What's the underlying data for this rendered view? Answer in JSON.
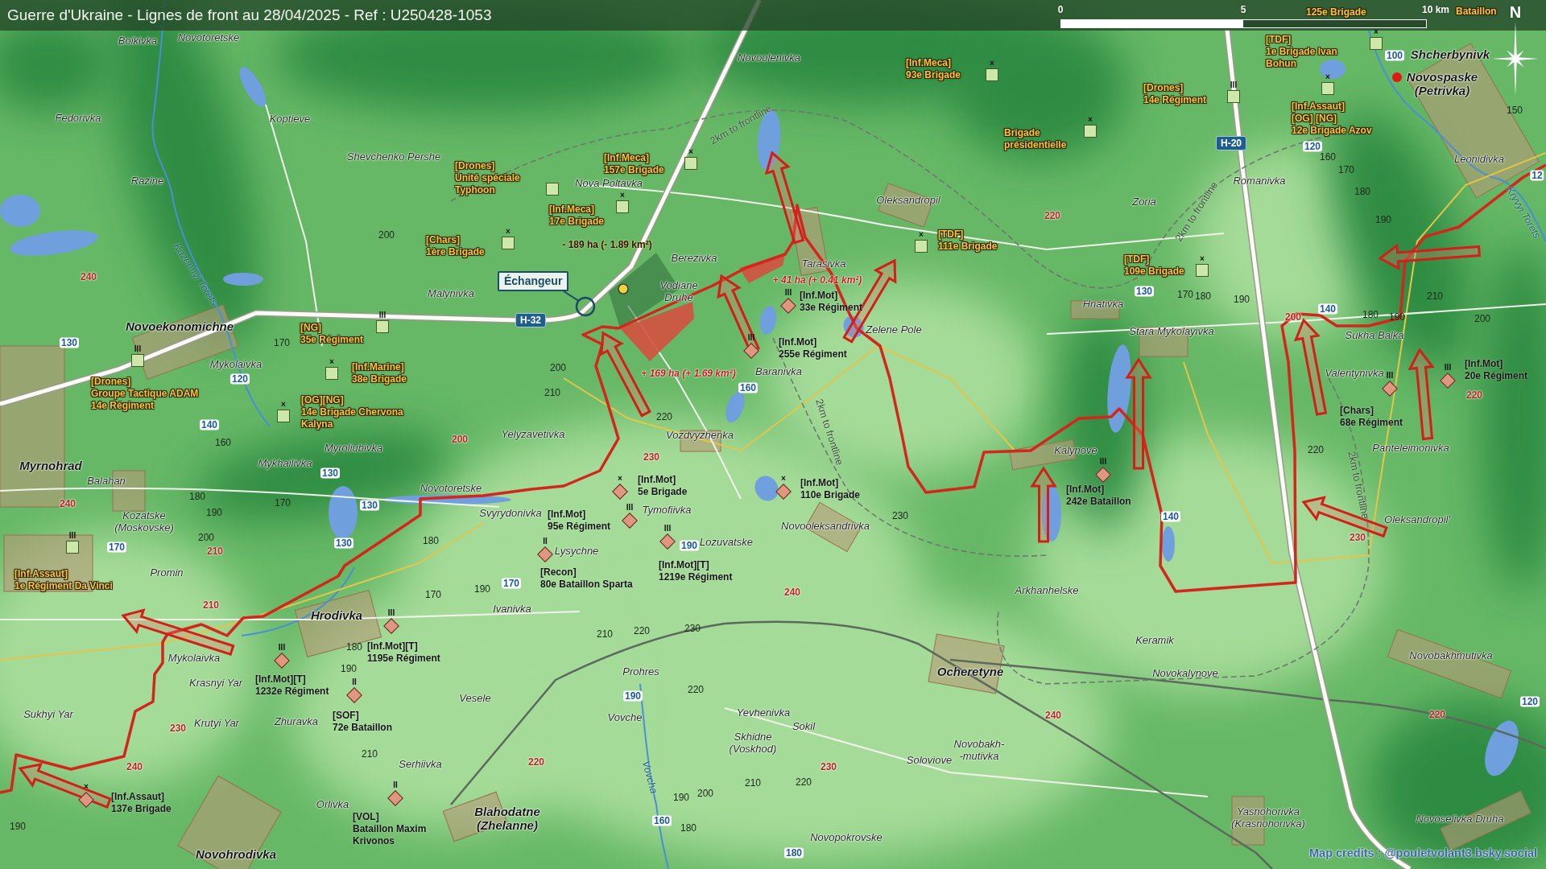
{
  "header": {
    "title": "Guerre d'Ukraine - Lignes de front au 28/04/2025 - Ref : U250428-1053"
  },
  "scale_bar": {
    "ticks": [
      "0",
      "5",
      "10 km"
    ]
  },
  "compass": {
    "label": "N"
  },
  "units": [
    {
      "kind": "ukraine",
      "lines": [
        "125e Brigade"
      ]
    },
    {
      "kind": "ukraine",
      "lines": [
        "Bataillon"
      ]
    },
    {
      "kind": "ukraine",
      "echelon": "×",
      "lines": [
        "[Inf.Meca]",
        "93e Brigade"
      ]
    },
    {
      "kind": "ukraine",
      "echelon": "×",
      "lines": [
        "[TDF]",
        "1e Brigade Ivan",
        "Bohun"
      ]
    },
    {
      "kind": "ukraine",
      "echelon": "III",
      "lines": [
        "[Drones]",
        "14e Régiment"
      ]
    },
    {
      "kind": "ukraine",
      "echelon": "×",
      "lines": [
        "Brigade",
        "présidentielle"
      ]
    },
    {
      "kind": "ukraine",
      "echelon": "×",
      "lines": [
        "[Inf.Assaut]",
        "[OG] [NG]",
        "12e Brigade Azov"
      ]
    },
    {
      "kind": "ukraine",
      "lines": [
        "[Drones]",
        "Unité spéciale",
        "Typhoon"
      ]
    },
    {
      "kind": "ukraine",
      "echelon": "×",
      "lines": [
        "[Inf.Meca]",
        "157e Brigade"
      ]
    },
    {
      "kind": "ukraine",
      "echelon": "×",
      "lines": [
        "[Inf.Meca]",
        "17e Brigade"
      ]
    },
    {
      "kind": "ukraine",
      "echelon": "×",
      "lines": [
        "[Chars]",
        "1ère Brigade"
      ]
    },
    {
      "kind": "ukraine",
      "echelon": "×",
      "lines": [
        "[TDF]",
        "111e Brigade"
      ]
    },
    {
      "kind": "ukraine",
      "echelon": "×",
      "lines": [
        "[TDF]",
        "109e Brigade"
      ]
    },
    {
      "kind": "russia",
      "echelon": "III",
      "lines": [
        "[Inf.Mot]",
        "33e Régiment"
      ]
    },
    {
      "kind": "ukraine",
      "echelon": "III",
      "lines": [
        "[NG]",
        "35e Régiment"
      ]
    },
    {
      "kind": "russia",
      "echelon": "III",
      "lines": [
        "[Inf.Mot]",
        "255e Régiment"
      ]
    },
    {
      "kind": "ukraine",
      "echelon": "III",
      "lines": [
        "[Drones]",
        "Groupe Tactique ADAM",
        "14e Régiment"
      ]
    },
    {
      "kind": "ukraine",
      "echelon": "×",
      "lines": [
        "[Inf.Marine]",
        "38e Brigade"
      ]
    },
    {
      "kind": "russia",
      "echelon": "III",
      "lines": [
        "[Inf.Mot]",
        "20e Régiment"
      ]
    },
    {
      "kind": "ukraine",
      "echelon": "×",
      "lines": [
        "[OG][NG]",
        "14e Brigade Chervona",
        "Kalyna"
      ]
    },
    {
      "kind": "russia",
      "echelon": "III",
      "lines": [
        "[Chars]",
        "68e Régiment"
      ]
    },
    {
      "kind": "russia",
      "echelon": "×",
      "lines": [
        "[Inf.Mot]",
        "5e Brigade"
      ]
    },
    {
      "kind": "russia",
      "echelon": "×",
      "lines": [
        "[Inf.Mot]",
        "110e Brigade"
      ]
    },
    {
      "kind": "russia",
      "echelon": "III",
      "lines": [
        "[Inf.Mot]",
        "242e Bataillon"
      ]
    },
    {
      "kind": "russia",
      "echelon": "III",
      "lines": [
        "[Inf.Mot]",
        "95e Régiment"
      ]
    },
    {
      "kind": "ukraine",
      "echelon": "III",
      "lines": [
        "[Inf.Assaut]",
        "1e Régiment Da Vinci"
      ]
    },
    {
      "kind": "russia",
      "echelon": "II",
      "lines": [
        "[Recon]",
        "80e Bataillon Sparta"
      ]
    },
    {
      "kind": "russia",
      "echelon": "III",
      "lines": [
        "[Inf.Mot][T]",
        "1219e Régiment"
      ]
    },
    {
      "kind": "russia",
      "echelon": "III",
      "lines": [
        "[Inf.Mot][T]",
        "1195e Régiment"
      ]
    },
    {
      "kind": "russia",
      "echelon": "III",
      "lines": [
        "[Inf.Mot][T]",
        "1232e Régiment"
      ]
    },
    {
      "kind": "russia",
      "echelon": "II",
      "lines": [
        "[SOF]",
        "72e Bataillon"
      ]
    },
    {
      "kind": "russia",
      "echelon": "×",
      "lines": [
        "[Inf.Assaut]",
        "137e Brigade"
      ]
    },
    {
      "kind": "russia",
      "echelon": "II",
      "lines": [
        "[VOL]",
        "Bataillon Maxim",
        "Krivonos"
      ]
    }
  ],
  "places": [
    {
      "kind": "village",
      "lines": [
        "Boikivka"
      ]
    },
    {
      "kind": "village",
      "lines": [
        "Novotoretske"
      ]
    },
    {
      "kind": "village",
      "lines": [
        "Novoolenivka"
      ]
    },
    {
      "kind": "town",
      "lines": [
        "Shcherbynivk"
      ]
    },
    {
      "kind": "town",
      "lines": [
        "Novospaske",
        "(Petrivka)"
      ]
    },
    {
      "kind": "village",
      "lines": [
        "Fedorivka"
      ]
    },
    {
      "kind": "village",
      "lines": [
        "Koptieve"
      ]
    },
    {
      "kind": "village",
      "lines": [
        "Shevchenko Pershe"
      ]
    },
    {
      "kind": "village",
      "lines": [
        "Leonidivka"
      ]
    },
    {
      "kind": "village",
      "lines": [
        "Razine"
      ]
    },
    {
      "kind": "village",
      "lines": [
        "Nova Poltavka"
      ]
    },
    {
      "kind": "village",
      "lines": [
        "Romanivka"
      ]
    },
    {
      "kind": "village",
      "lines": [
        "Oleksandropil"
      ]
    },
    {
      "kind": "village",
      "lines": [
        "Zoria"
      ]
    },
    {
      "kind": "village",
      "lines": [
        "Berezivka"
      ]
    },
    {
      "kind": "village",
      "lines": [
        "Tarasivka"
      ]
    },
    {
      "kind": "village",
      "lines": [
        "Malynivka"
      ]
    },
    {
      "kind": "village",
      "lines": [
        "Vodiane",
        "Druhe"
      ]
    },
    {
      "kind": "village",
      "lines": [
        "Hnativka"
      ]
    },
    {
      "kind": "town",
      "lines": [
        "Novoekonomichne"
      ]
    },
    {
      "kind": "village",
      "lines": [
        "Zelene Pole"
      ]
    },
    {
      "kind": "village",
      "lines": [
        "Stara Mykolayivka"
      ]
    },
    {
      "kind": "village",
      "lines": [
        "Sukha Balka"
      ]
    },
    {
      "kind": "village",
      "lines": [
        "Mykolaivka"
      ]
    },
    {
      "kind": "village",
      "lines": [
        "Baranivka"
      ]
    },
    {
      "kind": "village",
      "lines": [
        "Valentynivka"
      ]
    },
    {
      "kind": "village",
      "lines": [
        "Yelyzavetivka"
      ]
    },
    {
      "kind": "village",
      "lines": [
        "Vozdvyzhenka"
      ]
    },
    {
      "kind": "village",
      "lines": [
        "Myroliubivka"
      ]
    },
    {
      "kind": "village",
      "lines": [
        "Kalynove"
      ]
    },
    {
      "kind": "village",
      "lines": [
        "Panteleimonivka"
      ]
    },
    {
      "kind": "town",
      "lines": [
        "Myrnohrad"
      ]
    },
    {
      "kind": "village",
      "lines": [
        "Mykhailivka"
      ]
    },
    {
      "kind": "village",
      "lines": [
        "Balahan"
      ]
    },
    {
      "kind": "village",
      "lines": [
        "Novotoretske"
      ]
    },
    {
      "kind": "village",
      "lines": [
        "Kozatske",
        "(Moskovske)"
      ]
    },
    {
      "kind": "village",
      "lines": [
        "Svyrydonivka"
      ]
    },
    {
      "kind": "village",
      "lines": [
        "Tymofiivka"
      ]
    },
    {
      "kind": "village",
      "lines": [
        "Novooleksandrivka"
      ]
    },
    {
      "kind": "village",
      "lines": [
        "Oleksandropil'"
      ]
    },
    {
      "kind": "village",
      "lines": [
        "Lysychne"
      ]
    },
    {
      "kind": "village",
      "lines": [
        "Lozuvatske"
      ]
    },
    {
      "kind": "village",
      "lines": [
        "Promin"
      ]
    },
    {
      "kind": "village",
      "lines": [
        "Arkhanhelske"
      ]
    },
    {
      "kind": "town",
      "lines": [
        "Hrodivka"
      ]
    },
    {
      "kind": "village",
      "lines": [
        "Ivanivka"
      ]
    },
    {
      "kind": "village",
      "lines": [
        "Keramik"
      ]
    },
    {
      "kind": "village",
      "lines": [
        "Mykolaivka"
      ]
    },
    {
      "kind": "village",
      "lines": [
        "Novobakhmutivka"
      ]
    },
    {
      "kind": "village",
      "lines": [
        "Krasnyi Yar"
      ]
    },
    {
      "kind": "village",
      "lines": [
        "Prohres"
      ]
    },
    {
      "kind": "town",
      "lines": [
        "Ocheretyne"
      ]
    },
    {
      "kind": "village",
      "lines": [
        "Novokalynove"
      ]
    },
    {
      "kind": "village",
      "lines": [
        "Vesele"
      ]
    },
    {
      "kind": "village",
      "lines": [
        "Sukhyi Yar"
      ]
    },
    {
      "kind": "village",
      "lines": [
        "Krutyi Yar"
      ]
    },
    {
      "kind": "village",
      "lines": [
        "Zhuravka"
      ]
    },
    {
      "kind": "village",
      "lines": [
        "Vovche"
      ]
    },
    {
      "kind": "village",
      "lines": [
        "Yevhenivka"
      ]
    },
    {
      "kind": "village",
      "lines": [
        "Skhidne",
        "(Voskhod)"
      ]
    },
    {
      "kind": "village",
      "lines": [
        "Sokil"
      ]
    },
    {
      "kind": "village",
      "lines": [
        "Serhiivka"
      ]
    },
    {
      "kind": "village",
      "lines": [
        "Soloviove"
      ]
    },
    {
      "kind": "village",
      "lines": [
        "Novobakh-",
        "-mutivka"
      ]
    },
    {
      "kind": "village",
      "lines": [
        "Orlivka"
      ]
    },
    {
      "kind": "town",
      "lines": [
        "Blahodatne",
        "(Zhelanne)"
      ]
    },
    {
      "kind": "village",
      "lines": [
        "Yasnohorivka",
        "(Krasnohorivka)"
      ]
    },
    {
      "kind": "village",
      "lines": [
        "Novoselivka Druha"
      ]
    },
    {
      "kind": "village",
      "lines": [
        "Novopokrovske"
      ]
    },
    {
      "kind": "town",
      "lines": [
        "Novohrodivka"
      ]
    }
  ],
  "heights": [
    {
      "value": "100",
      "kind": "water"
    },
    {
      "value": "150",
      "kind": "contour"
    },
    {
      "value": "120",
      "kind": "water"
    },
    {
      "value": "160",
      "kind": "contour"
    },
    {
      "value": "170",
      "kind": "contour"
    },
    {
      "value": "12",
      "kind": "water"
    },
    {
      "value": "180",
      "kind": "contour"
    },
    {
      "value": "220",
      "kind": "summit"
    },
    {
      "value": "190",
      "kind": "contour"
    },
    {
      "value": "200",
      "kind": "contour"
    },
    {
      "value": "240",
      "kind": "summit"
    },
    {
      "value": "130",
      "kind": "water"
    },
    {
      "value": "170",
      "kind": "contour"
    },
    {
      "value": "180",
      "kind": "contour"
    },
    {
      "value": "190",
      "kind": "contour"
    },
    {
      "value": "210",
      "kind": "contour"
    },
    {
      "value": "200",
      "kind": "summit"
    },
    {
      "value": "140",
      "kind": "water"
    },
    {
      "value": "180",
      "kind": "contour"
    },
    {
      "value": "190",
      "kind": "contour"
    },
    {
      "value": "200",
      "kind": "contour"
    },
    {
      "value": "130",
      "kind": "water"
    },
    {
      "value": "170",
      "kind": "contour"
    },
    {
      "value": "200",
      "kind": "contour"
    },
    {
      "value": "120",
      "kind": "water"
    },
    {
      "value": "210",
      "kind": "contour"
    },
    {
      "value": "160",
      "kind": "water"
    },
    {
      "value": "220",
      "kind": "summit"
    },
    {
      "value": "140",
      "kind": "water"
    },
    {
      "value": "220",
      "kind": "contour"
    },
    {
      "value": "160",
      "kind": "contour"
    },
    {
      "value": "200",
      "kind": "summit"
    },
    {
      "value": "230",
      "kind": "summit"
    },
    {
      "value": "220",
      "kind": "contour"
    },
    {
      "value": "130",
      "kind": "water"
    },
    {
      "value": "240",
      "kind": "summit"
    },
    {
      "value": "180",
      "kind": "contour"
    },
    {
      "value": "190",
      "kind": "contour"
    },
    {
      "value": "170",
      "kind": "contour"
    },
    {
      "value": "130",
      "kind": "water"
    },
    {
      "value": "230",
      "kind": "contour"
    },
    {
      "value": "140",
      "kind": "water"
    },
    {
      "value": "170",
      "kind": "water"
    },
    {
      "value": "200",
      "kind": "contour"
    },
    {
      "value": "210",
      "kind": "summit"
    },
    {
      "value": "130",
      "kind": "water"
    },
    {
      "value": "180",
      "kind": "contour"
    },
    {
      "value": "190",
      "kind": "water"
    },
    {
      "value": "230",
      "kind": "summit"
    },
    {
      "value": "170",
      "kind": "contour"
    },
    {
      "value": "190",
      "kind": "contour"
    },
    {
      "value": "170",
      "kind": "water"
    },
    {
      "value": "240",
      "kind": "summit"
    },
    {
      "value": "210",
      "kind": "summit"
    },
    {
      "value": "210",
      "kind": "contour"
    },
    {
      "value": "220",
      "kind": "contour"
    },
    {
      "value": "230",
      "kind": "contour"
    },
    {
      "value": "180",
      "kind": "contour"
    },
    {
      "value": "190",
      "kind": "contour"
    },
    {
      "value": "190",
      "kind": "water"
    },
    {
      "value": "220",
      "kind": "contour"
    },
    {
      "value": "120",
      "kind": "water"
    },
    {
      "value": "240",
      "kind": "summit"
    },
    {
      "value": "220",
      "kind": "summit"
    },
    {
      "value": "230",
      "kind": "summit"
    },
    {
      "value": "210",
      "kind": "contour"
    },
    {
      "value": "240",
      "kind": "summit"
    },
    {
      "value": "220",
      "kind": "summit"
    },
    {
      "value": "230",
      "kind": "summit"
    },
    {
      "value": "210",
      "kind": "contour"
    },
    {
      "value": "220",
      "kind": "contour"
    },
    {
      "value": "190",
      "kind": "contour"
    },
    {
      "value": "200",
      "kind": "contour"
    },
    {
      "value": "190",
      "kind": "contour"
    },
    {
      "value": "160",
      "kind": "water"
    },
    {
      "value": "180",
      "kind": "contour"
    },
    {
      "value": "180",
      "kind": "water"
    }
  ],
  "highways": [
    "H-20",
    "H-32"
  ],
  "rivers": [
    "Kryvyi Torets",
    "Kazennyi Torets",
    "Vovcha"
  ],
  "buffer_labels": [
    "2km to frontline",
    "2km to frontline",
    "2km to frontline",
    "2km to frontline"
  ],
  "callout": {
    "label": "Échangeur"
  },
  "area_changes": [
    {
      "kind": "loss",
      "label": "- 189 ha (- 1.89 km²)"
    },
    {
      "kind": "gain",
      "label": "+ 41 ha (+ 0.41 km²)"
    },
    {
      "kind": "gain",
      "label": "+ 169 ha (+ 1.69 km²)"
    }
  ],
  "credits": "Map credits : @pouletvolant3.bsky.social"
}
